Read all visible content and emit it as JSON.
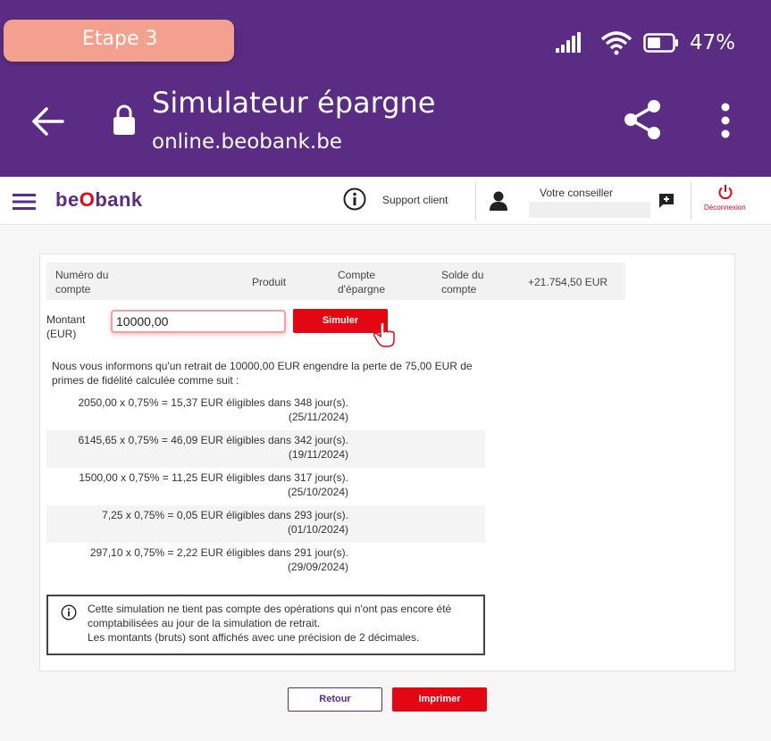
{
  "overlay": {
    "step_label": "Etape 3"
  },
  "status_bar": {
    "battery_percent": "47%",
    "icons": [
      "signal-icon",
      "wifi-icon",
      "battery-icon"
    ]
  },
  "browser": {
    "title": "Simulateur épargne",
    "url": "online.beobank.be"
  },
  "header": {
    "logo_prefix": "be",
    "logo_o": "O",
    "logo_suffix": "bank",
    "support_label": "Support client",
    "conseiller_label": "Votre conseiller",
    "logout_label": "Déconnexion"
  },
  "account": {
    "col1": "Numéro du compte",
    "col2": "Produit",
    "col3": "Compte d'épargne",
    "col4": "Solde du compte",
    "balance": "+21.754,50 EUR"
  },
  "form": {
    "amount_label": "Montant (EUR)",
    "amount_value": "10000,00",
    "simulate_button": "Simuler"
  },
  "info": "Nous vous informons qu'un retrait de 10000,00 EUR engendre la perte de 75,00 EUR de primes de fidélité calculée comme suit :",
  "calculations": [
    {
      "line": "2050,00 x 0,75% = 15,37 EUR éligibles dans 348 jour(s).",
      "date": "(25/11/2024)"
    },
    {
      "line": "6145,65 x 0,75% = 46,09 EUR éligibles dans 342 jour(s).",
      "date": "(19/11/2024)"
    },
    {
      "line": "1500,00 x 0,75% = 11,25 EUR éligibles dans 317 jour(s).",
      "date": "(25/10/2024)"
    },
    {
      "line": "7,25 x 0,75% = 0,05 EUR éligibles dans 293 jour(s).",
      "date": "(01/10/2024)"
    },
    {
      "line": "297,10 x 0,75% = 2,22 EUR éligibles dans 291 jour(s).",
      "date": "(29/09/2024)"
    }
  ],
  "note": {
    "line1": "Cette simulation ne tient pas compte des opérations qui n'ont pas encore été",
    "line2": "comptabilisées au jour de la simulation de retrait.",
    "line3": "Les montants (bruts) sont affichés avec une précision de 2 décimales."
  },
  "footer": {
    "back_button": "Retour",
    "print_button": "Imprimer"
  },
  "colors": {
    "purple": "#5b2c83",
    "red": "#e30613",
    "pill": "#f4a08f"
  }
}
